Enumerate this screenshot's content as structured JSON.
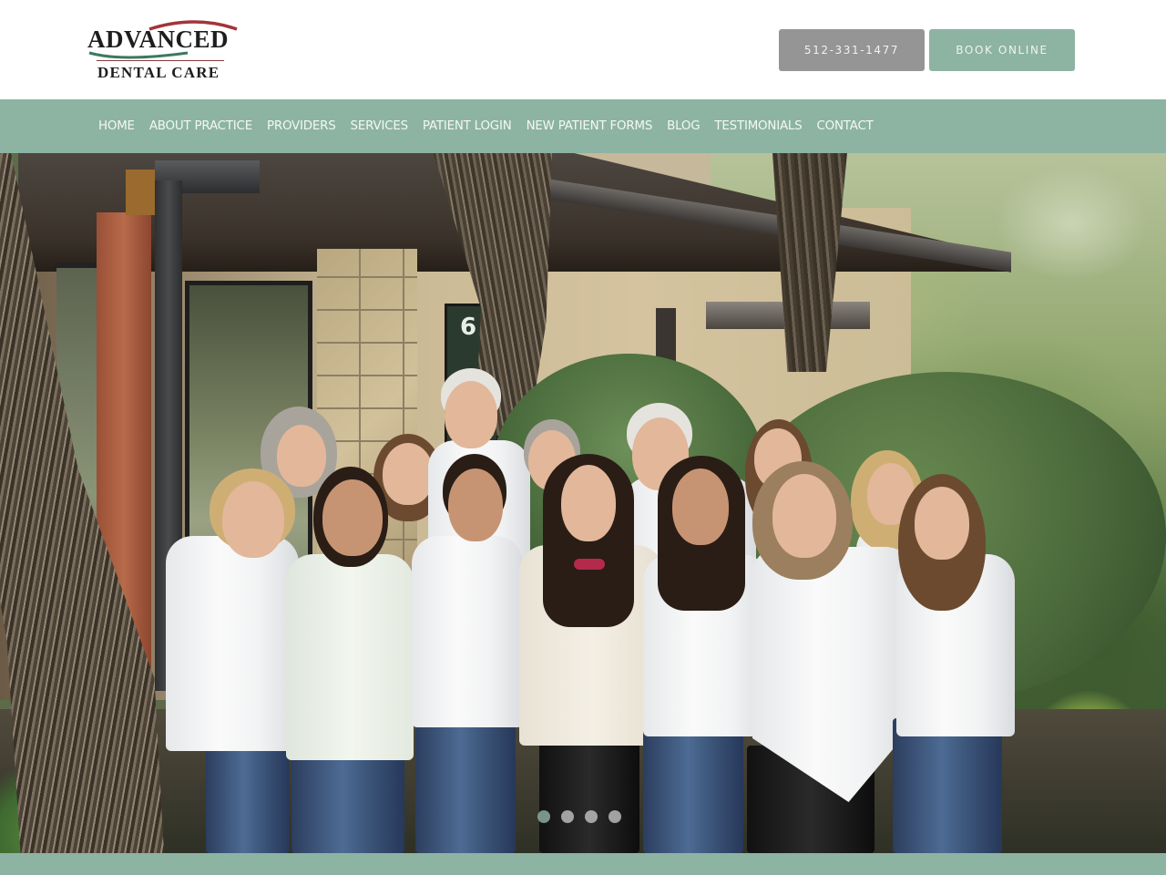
{
  "header": {
    "logo": {
      "main": "ADVANCED",
      "sub": "DENTAL CARE",
      "arc_color_red": "#a4343a",
      "arc_color_green": "#3b7a5e"
    },
    "phone_button": "512-331-1477",
    "book_button": "BOOK ONLINE"
  },
  "nav": {
    "items": [
      {
        "label": "HOME"
      },
      {
        "label": "ABOUT PRACTICE"
      },
      {
        "label": "PROVIDERS"
      },
      {
        "label": "SERVICES"
      },
      {
        "label": "PATIENT LOGIN"
      },
      {
        "label": "NEW PATIENT FORMS"
      },
      {
        "label": "BLOG"
      },
      {
        "label": "TESTIMONIALS"
      },
      {
        "label": "CONTACT"
      }
    ]
  },
  "hero": {
    "image_description": "Team photo of dental office staff in white shirts standing outside the building",
    "building_number_visible": "6",
    "slider": {
      "total_slides": 4,
      "active_slide": 1
    }
  },
  "colors": {
    "brand_sage": "#8db3a3",
    "phone_button_gray": "#959595",
    "nav_text": "#f4f7f5"
  }
}
